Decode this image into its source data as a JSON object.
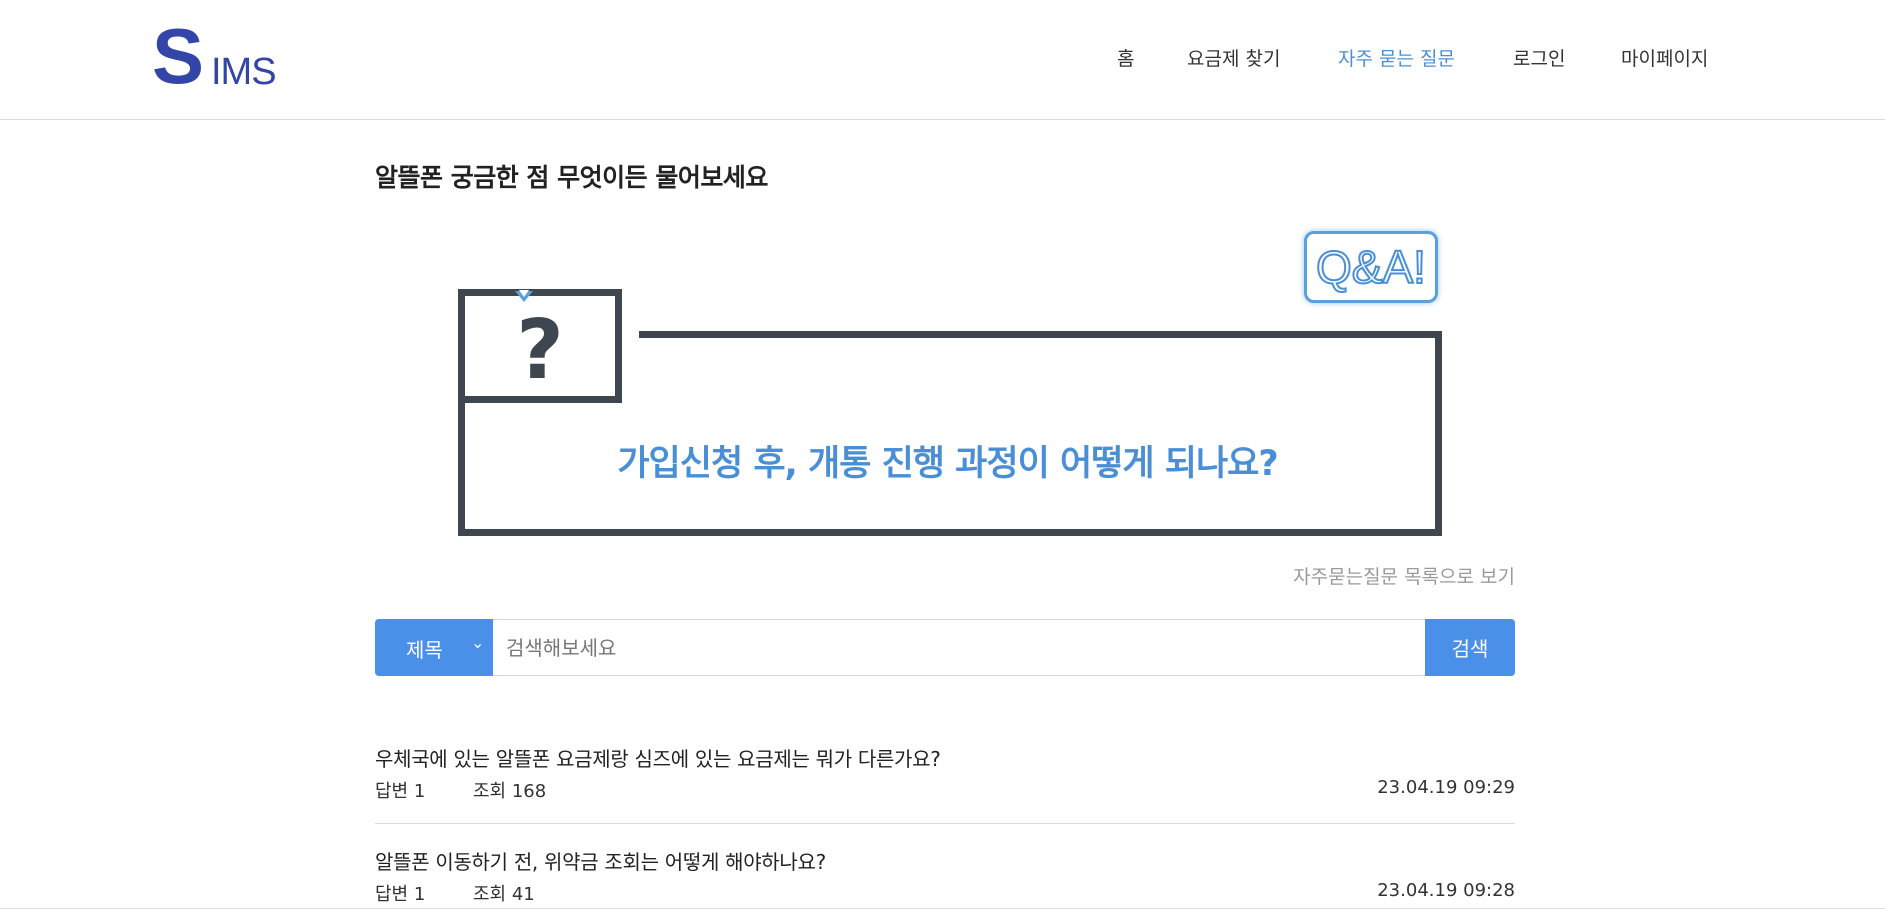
{
  "brand": {
    "logo_s": "S",
    "logo_ims": "IMS"
  },
  "nav": {
    "items": [
      {
        "label": "홈"
      },
      {
        "label": "요금제 찾기"
      },
      {
        "label": "자주 묻는 질문",
        "active": true
      },
      {
        "label": "로그인"
      },
      {
        "label": "마이페이지"
      }
    ]
  },
  "main": {
    "title": "알뜰폰 궁금한 점 무엇이든 물어보세요",
    "banner": {
      "question_mark": "?",
      "badge": "Q&A!",
      "question": "가입신청 후, 개통 진행 과정이 어떻게 되나요?"
    },
    "list_link": "자주묻는질문 목록으로 보기"
  },
  "search": {
    "select_value": "제목",
    "placeholder": "검색해보세요",
    "button_label": "검색"
  },
  "faqs": [
    {
      "title": "우체국에 있는 알뜰폰 요금제랑 심즈에 있는 요금제는 뭐가 다른가요?",
      "answers": "답변 1",
      "views": "조회 168",
      "date": "23.04.19 09:29"
    },
    {
      "title": "알뜰폰 이동하기 전, 위약금 조회는 어떻게 해야하나요?",
      "answers": "답변 1",
      "views": "조회 41",
      "date": "23.04.19 09:28"
    }
  ],
  "colors": {
    "brand": "#3345a6",
    "accent": "#4a8fd6",
    "button": "#4a8fe8",
    "frame": "#3e4750"
  },
  "icons": {
    "select_chevron": "chevron-down-icon"
  }
}
